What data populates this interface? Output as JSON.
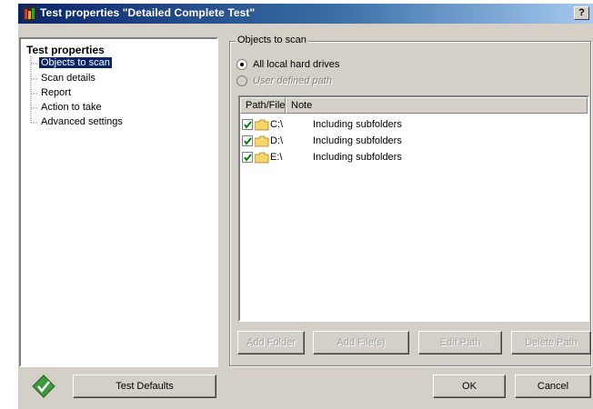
{
  "window": {
    "title": "Test properties \"Detailed Complete Test\"",
    "help_label": "?"
  },
  "tree": {
    "root_label": "Test properties",
    "items": [
      {
        "label": "Objects to scan",
        "selected": true
      },
      {
        "label": "Scan details",
        "selected": false
      },
      {
        "label": "Report",
        "selected": false
      },
      {
        "label": "Action to take",
        "selected": false
      },
      {
        "label": "Advanced settings",
        "selected": false
      }
    ]
  },
  "objects_group": {
    "legend": "Objects to scan",
    "radio_all_label": "All local hard drives",
    "radio_all_checked": true,
    "radio_user_label": "User defined path",
    "radio_user_checked": false
  },
  "list": {
    "columns": [
      "Path/File",
      "Note"
    ],
    "rows": [
      {
        "path": "C:\\",
        "note": "Including subfolders",
        "checked": true
      },
      {
        "path": "D:\\",
        "note": "Including subfolders",
        "checked": true
      },
      {
        "path": "E:\\",
        "note": "Including subfolders",
        "checked": true
      }
    ]
  },
  "list_buttons": {
    "add_folder": "Add Folder",
    "add_files": "Add File(s)",
    "edit_path": "Edit Path",
    "delete_path": "Delete Path"
  },
  "footer": {
    "test_defaults_label": "Test Defaults",
    "ok_label": "OK",
    "cancel_label": "Cancel"
  },
  "icons": {
    "app": "avg-app-icon",
    "status": "green-diamond-check-icon",
    "folder": "folder-icon",
    "check": "checkbox-checked-icon"
  },
  "colors": {
    "title_gradient_start": "#0a246a",
    "title_gradient_end": "#a6caf0",
    "face": "#d4d0c8",
    "selection": "#0a246a",
    "check_green": "#008000"
  }
}
